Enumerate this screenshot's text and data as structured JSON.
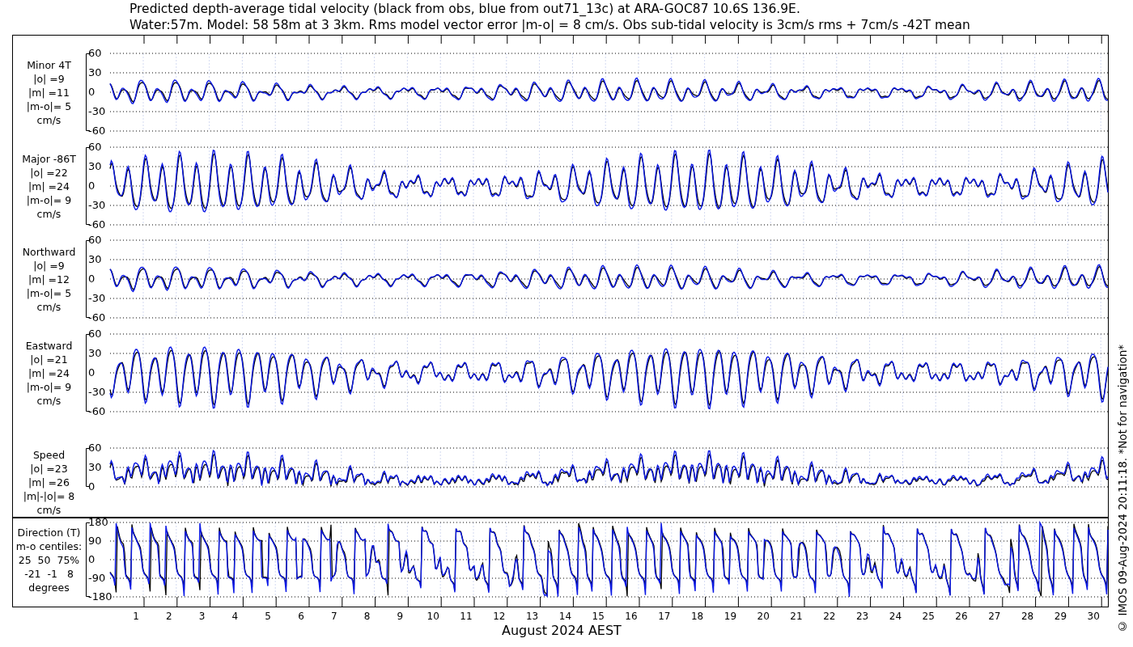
{
  "title": {
    "lines": [
      "Predicted depth-average tidal velocity (black from obs, blue from out71_13c) at ARA-GOC87 10.6S 136.9E.",
      "Water:57m. Model: 58 58m at 3 3km. Rms model vector error |m-o| = 8 cm/s. Obs sub-tidal velocity is 3cm/s rms + 7cm/s -42T mean"
    ]
  },
  "panels": [
    {
      "kind": "minor",
      "label_lines": [
        "Minor 4T",
        "|o| =9",
        "|m| =11",
        "|m-o|= 5",
        "cm/s"
      ],
      "yticks": [
        "60",
        "30",
        "0",
        "-30",
        "-60"
      ]
    },
    {
      "kind": "major",
      "label_lines": [
        "Major -86T",
        "|o| =22",
        "|m| =24",
        "|m-o|= 9",
        "cm/s"
      ],
      "yticks": [
        "60",
        "30",
        "0",
        "-30",
        "-60"
      ]
    },
    {
      "kind": "northward",
      "label_lines": [
        "Northward",
        "|o| =9",
        "|m| =12",
        "|m-o|= 5",
        "cm/s"
      ],
      "yticks": [
        "60",
        "30",
        "0",
        "-30",
        "-60"
      ]
    },
    {
      "kind": "eastward",
      "label_lines": [
        "Eastward",
        "|o| =21",
        "|m| =24",
        "|m-o|= 9",
        "cm/s"
      ],
      "yticks": [
        "60",
        "30",
        "0",
        "-30",
        "-60"
      ]
    },
    {
      "kind": "speed",
      "label_lines": [
        "Speed",
        "|o| =23",
        "|m| =26",
        "|m|-|o|= 8",
        "cm/s"
      ],
      "yticks": [
        "60",
        "30",
        "0"
      ]
    }
  ],
  "direction_panel": {
    "kind": "direction",
    "label_lines": [
      "Direction (T)",
      "m-o centiles:",
      "25  50  75%",
      "-21  -1   8",
      "degrees"
    ],
    "yticks": [
      "180",
      "90",
      "0",
      "-90",
      "-180"
    ]
  },
  "x_axis": {
    "day_labels": [
      "1",
      "2",
      "3",
      "4",
      "5",
      "6",
      "7",
      "8",
      "9",
      "10",
      "11",
      "12",
      "13",
      "14",
      "15",
      "16",
      "17",
      "18",
      "19",
      "20",
      "21",
      "22",
      "23",
      "24",
      "25",
      "26",
      "27",
      "28",
      "29",
      "30"
    ],
    "label": "August 2024 AEST"
  },
  "footer": "© IMOS 09-Aug-2024 20:11:18. *Not for navigation*"
}
